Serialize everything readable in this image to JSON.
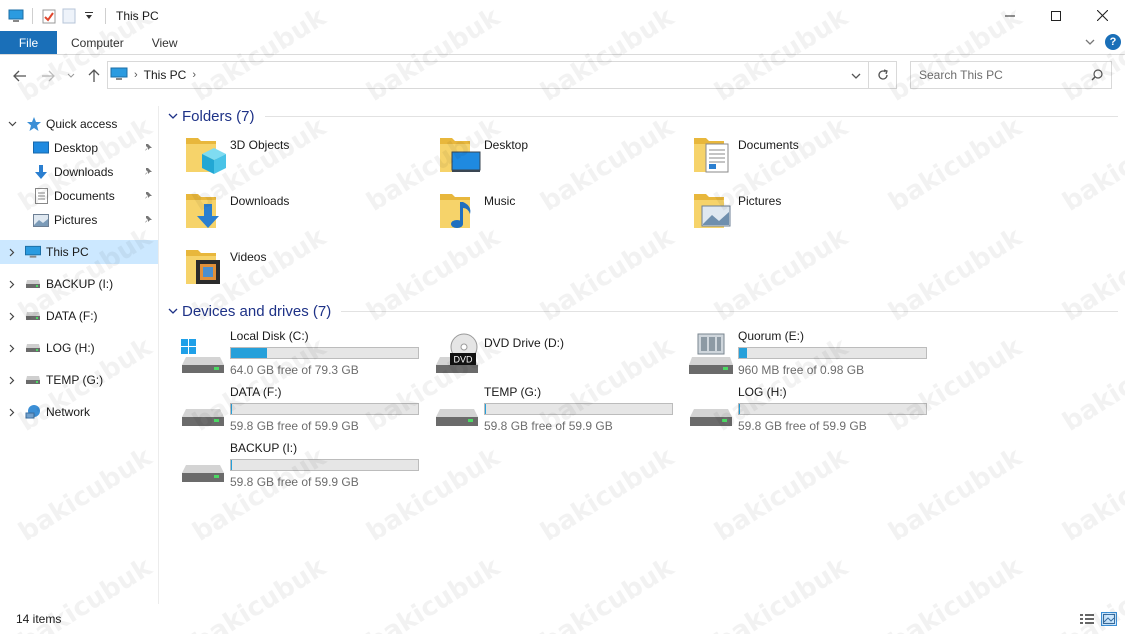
{
  "titlebar": {
    "title": "This PC",
    "controls": {
      "minimize": "minimize-icon",
      "maximize": "maximize-icon",
      "close": "close-icon"
    }
  },
  "ribbon": {
    "tabs": [
      "File",
      "Computer",
      "View"
    ],
    "help": "?"
  },
  "address": {
    "location": "This PC",
    "search_placeholder": "Search This PC"
  },
  "sidebar": {
    "items": [
      {
        "label": "Quick access",
        "icon": "star-icon",
        "expanded": true
      },
      {
        "label": "Desktop",
        "icon": "desktop-icon",
        "pinned": true
      },
      {
        "label": "Downloads",
        "icon": "download-arrow-icon",
        "pinned": true
      },
      {
        "label": "Documents",
        "icon": "document-icon",
        "pinned": true
      },
      {
        "label": "Pictures",
        "icon": "pictures-icon",
        "pinned": true
      },
      {
        "label": "This PC",
        "icon": "computer-icon",
        "selected": true
      },
      {
        "label": "BACKUP (I:)",
        "icon": "drive-icon"
      },
      {
        "label": "DATA (F:)",
        "icon": "drive-icon"
      },
      {
        "label": "LOG (H:)",
        "icon": "drive-icon"
      },
      {
        "label": "TEMP (G:)",
        "icon": "drive-icon"
      },
      {
        "label": "Network",
        "icon": "network-icon"
      }
    ]
  },
  "folders": {
    "title": "Folders (7)",
    "items": [
      {
        "name": "3D Objects",
        "icon": "3d-objects-folder-icon"
      },
      {
        "name": "Desktop",
        "icon": "desktop-folder-icon"
      },
      {
        "name": "Documents",
        "icon": "documents-folder-icon"
      },
      {
        "name": "Downloads",
        "icon": "downloads-folder-icon"
      },
      {
        "name": "Music",
        "icon": "music-folder-icon"
      },
      {
        "name": "Pictures",
        "icon": "pictures-folder-icon"
      },
      {
        "name": "Videos",
        "icon": "videos-folder-icon"
      }
    ]
  },
  "drives": {
    "title": "Devices and drives (7)",
    "items": [
      {
        "name": "Local Disk (C:)",
        "free": "64.0 GB free of 79.3 GB",
        "used_fraction": 0.193,
        "icon": "windows-drive-icon"
      },
      {
        "name": "DVD Drive (D:)",
        "free": "",
        "used_fraction": null,
        "icon": "dvd-drive-icon"
      },
      {
        "name": "Quorum (E:)",
        "free": "960 MB free of 0.98 GB",
        "used_fraction": 0.043,
        "icon": "network-server-icon"
      },
      {
        "name": "DATA (F:)",
        "free": "59.8 GB free of 59.9 GB",
        "used_fraction": 0.002,
        "icon": "drive-icon"
      },
      {
        "name": "TEMP (G:)",
        "free": "59.8 GB free of 59.9 GB",
        "used_fraction": 0.002,
        "icon": "drive-icon"
      },
      {
        "name": "LOG (H:)",
        "free": "59.8 GB free of 59.9 GB",
        "used_fraction": 0.002,
        "icon": "drive-icon"
      },
      {
        "name": "BACKUP (I:)",
        "free": "59.8 GB free of 59.9 GB",
        "used_fraction": 0.002,
        "icon": "drive-icon"
      }
    ]
  },
  "status": {
    "count": "14 items"
  },
  "watermark": "bakicubuk",
  "colors": {
    "accent": "#1a6fb8",
    "selection": "#cce8ff",
    "group_title": "#1e3287",
    "bar_fill": "#26a0da"
  }
}
